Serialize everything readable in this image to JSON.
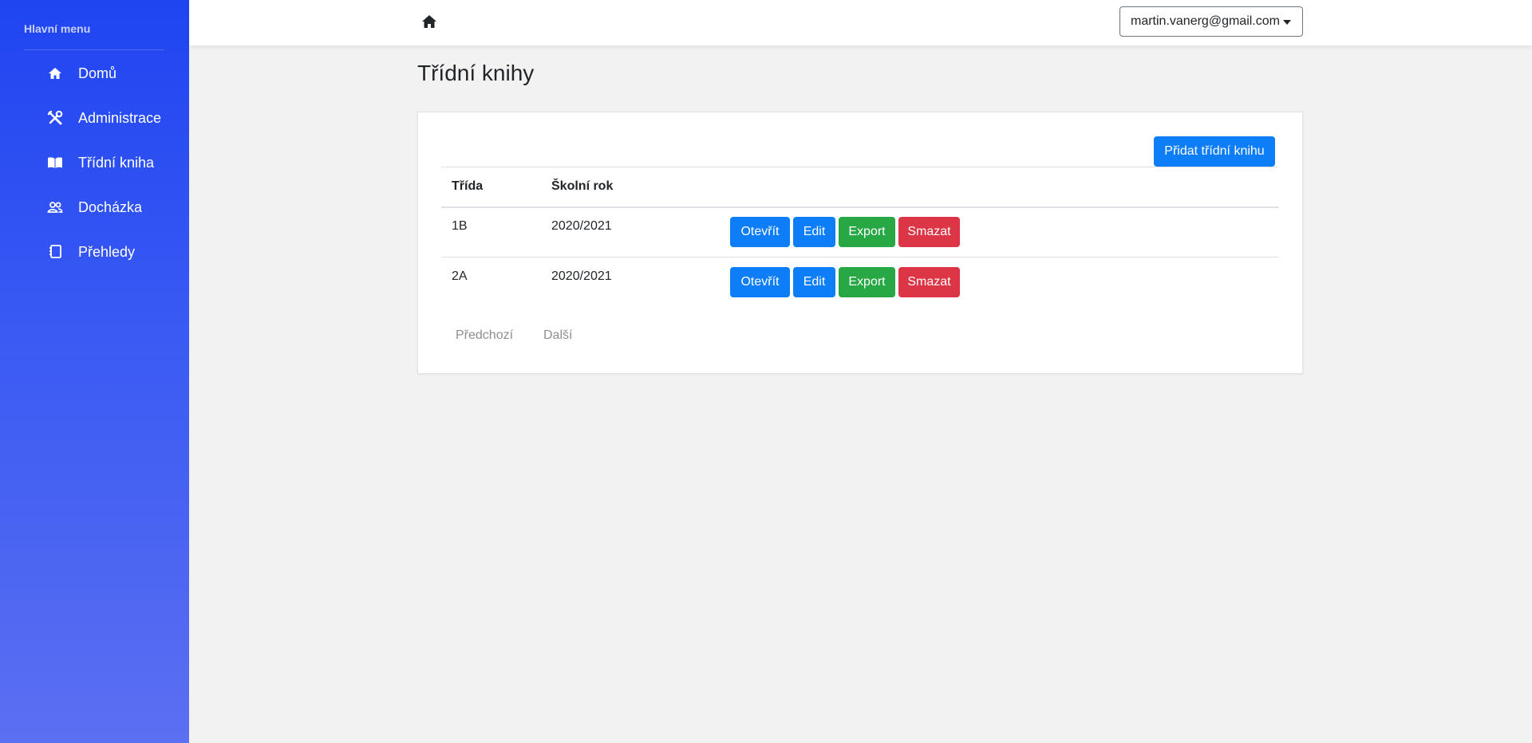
{
  "sidebar": {
    "heading": "Hlavní menu",
    "items": [
      {
        "label": "Domů",
        "icon": "home-icon"
      },
      {
        "label": "Administrace",
        "icon": "tools-icon"
      },
      {
        "label": "Třídní kniha",
        "icon": "book-icon"
      },
      {
        "label": "Docházka",
        "icon": "users-icon"
      },
      {
        "label": "Přehledy",
        "icon": "notebook-icon"
      }
    ]
  },
  "topbar": {
    "home_icon": "home-icon",
    "user_email": "martin.vanerg@gmail.com"
  },
  "page": {
    "title": "Třídní knihy"
  },
  "card": {
    "add_button_label": "Přidat třídní knihu",
    "columns": [
      "Třída",
      "Školní rok"
    ],
    "rows": [
      {
        "trida": "1B",
        "rok": "2020/2021"
      },
      {
        "trida": "2A",
        "rok": "2020/2021"
      }
    ],
    "actions": {
      "open": "Otevřít",
      "edit": "Edit",
      "export": "Export",
      "delete": "Smazat"
    },
    "pagination": {
      "prev": "Předchozí",
      "next": "Další"
    }
  },
  "colors": {
    "sidebar_top": "#1f45f2",
    "sidebar_bottom": "#5b6ff2",
    "primary": "#0d7df8",
    "success": "#27a844",
    "danger": "#dc3545"
  }
}
